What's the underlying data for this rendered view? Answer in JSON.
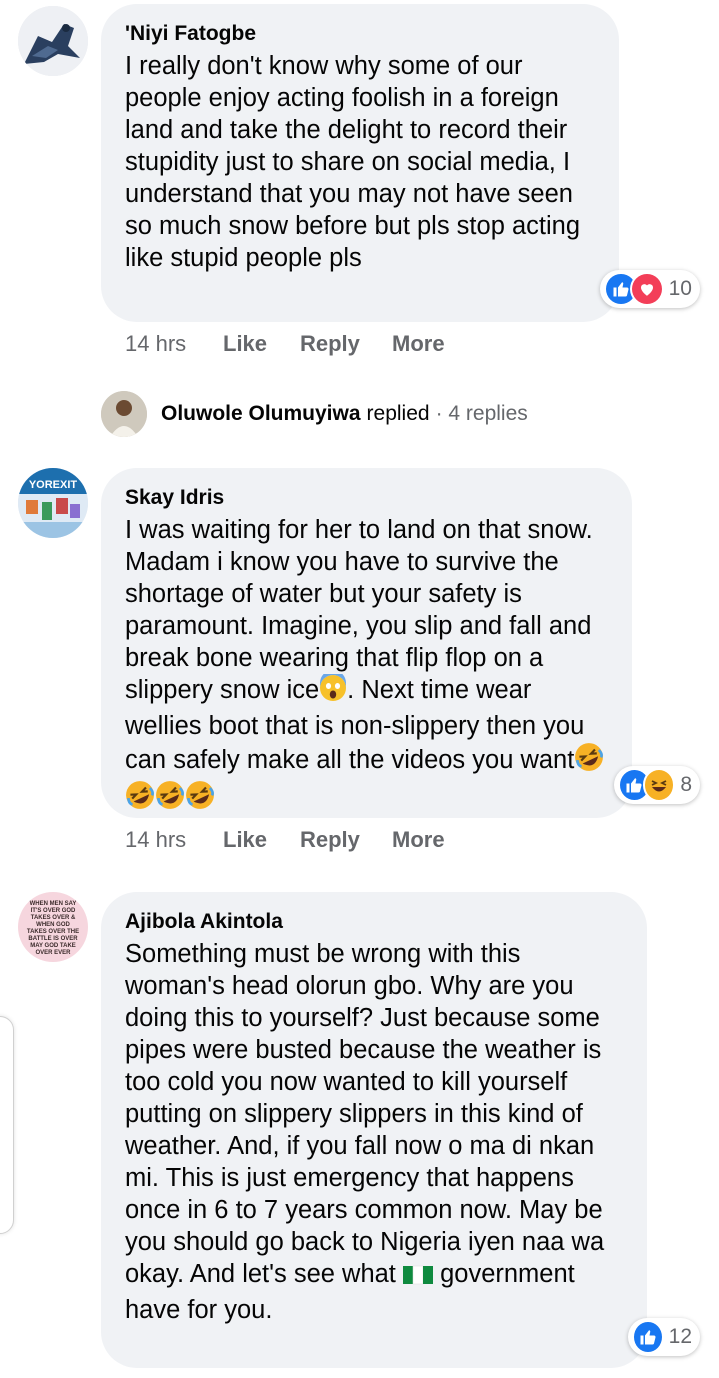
{
  "comments": [
    {
      "author": "'Niyi Fatogbe",
      "text": "I really don't know why some of our people enjoy acting foolish in a foreign land and take the delight to record their stupidity just to share on social media, I understand that you may not have seen so much snow before but pls stop acting like stupid people pls",
      "time": "14 hrs",
      "like": "Like",
      "reply": "Reply",
      "more": "More",
      "reaction_count": "10",
      "reactions": [
        "like-icon",
        "love-icon"
      ],
      "avatar": "leopard-avatar"
    },
    {
      "author": "Skay Idris",
      "text_parts": [
        "I was waiting for her to land on that snow. Madam i know you have to survive the shortage of water but your safety is paramount. Imagine, you slip and fall and break bone wearing that flip flop on a slippery snow ice",
        ". Next time wear wellies boot that is non-slippery then you can safely make all the videos you want"
      ],
      "time": "14 hrs",
      "like": "Like",
      "reply": "Reply",
      "more": "More",
      "reaction_count": "8",
      "reactions": [
        "like-icon",
        "haha-icon"
      ],
      "avatar": "yorexit-avatar",
      "avatar_text": "YOREXIT"
    },
    {
      "author": "Ajibola Akintola",
      "text_parts": [
        "Something must be wrong with this woman's head olorun gbo. Why are you doing this to yourself? Just because some pipes were busted because the weather is too cold you now wanted to kill yourself putting on slippery slippers in this kind of weather. And, if you fall now o ma di nkan mi. This is just emergency that happens once in 6 to 7 years common now. May be you should go back to Nigeria iyen naa wa okay. And let's see what",
        "government have for you."
      ],
      "reaction_count": "12",
      "reactions": [
        "like-icon"
      ],
      "avatar": "text-avatar",
      "avatar_text": "WHEN MEN SAY IT'S OVER GOD TAKES OVER & WHEN GOD TAKES OVER THE BATTLE IS OVER MAY GOD TAKE OVER EVER"
    }
  ],
  "reply_summary": {
    "name": "Oluwole Olumuyiwa",
    "verb": "replied",
    "count": "· 4 replies"
  },
  "colors": {
    "bubble": "#f0f2f5",
    "like_blue": "#1877f2",
    "love_red": "#f33e58",
    "haha_yellow": "#f7b125",
    "meta_gray": "#65676b"
  }
}
